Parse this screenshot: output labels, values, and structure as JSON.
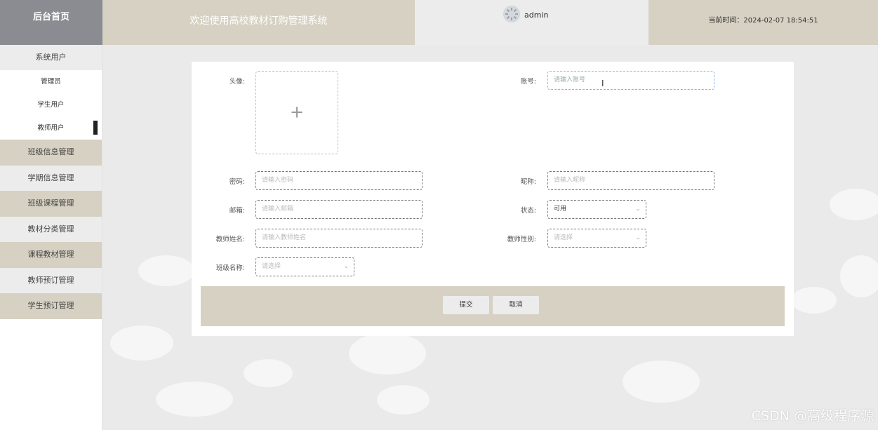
{
  "header": {
    "brand": "后台首页",
    "app_title": "欢迎使用高校教材订购管理系统",
    "username": "admin",
    "current_time": "当前时间：2024-02-07 18:54:51"
  },
  "sidebar": {
    "group_label": "系统用户",
    "sub_items": [
      "管理员",
      "学生用户",
      "教师用户"
    ],
    "items": [
      "班级信息管理",
      "学期信息管理",
      "班级课程管理",
      "教材分类管理",
      "课程教材管理",
      "教师预订管理",
      "学生预订管理"
    ]
  },
  "form": {
    "avatar_label": "头像:",
    "account_label": "账号:",
    "account_placeholder": "请输入账号",
    "password_label": "密码:",
    "password_placeholder": "请输入密码",
    "nickname_label": "昵称:",
    "nickname_placeholder": "请输入昵称",
    "email_label": "邮箱:",
    "email_placeholder": "请输入邮箱",
    "status_label": "状态:",
    "status_value": "可用",
    "teacher_name_label": "教师姓名:",
    "teacher_name_placeholder": "请输入教师姓名",
    "teacher_gender_label": "教师性别:",
    "teacher_gender_placeholder": "请选择",
    "class_name_label": "班级名称:",
    "class_name_placeholder": "请选择",
    "submit_label": "提交",
    "cancel_label": "取消"
  },
  "watermark": "CSDN @高级程序源",
  "colors": {
    "brand_bg": "#8a8c92",
    "accent_beige": "#d6d1c2",
    "menu_gray": "#ececec",
    "page_bg": "#eaeaea"
  },
  "icons": {
    "avatar": "user-avatar-icon",
    "upload": "plus-icon",
    "select": "chevron-down-icon"
  }
}
